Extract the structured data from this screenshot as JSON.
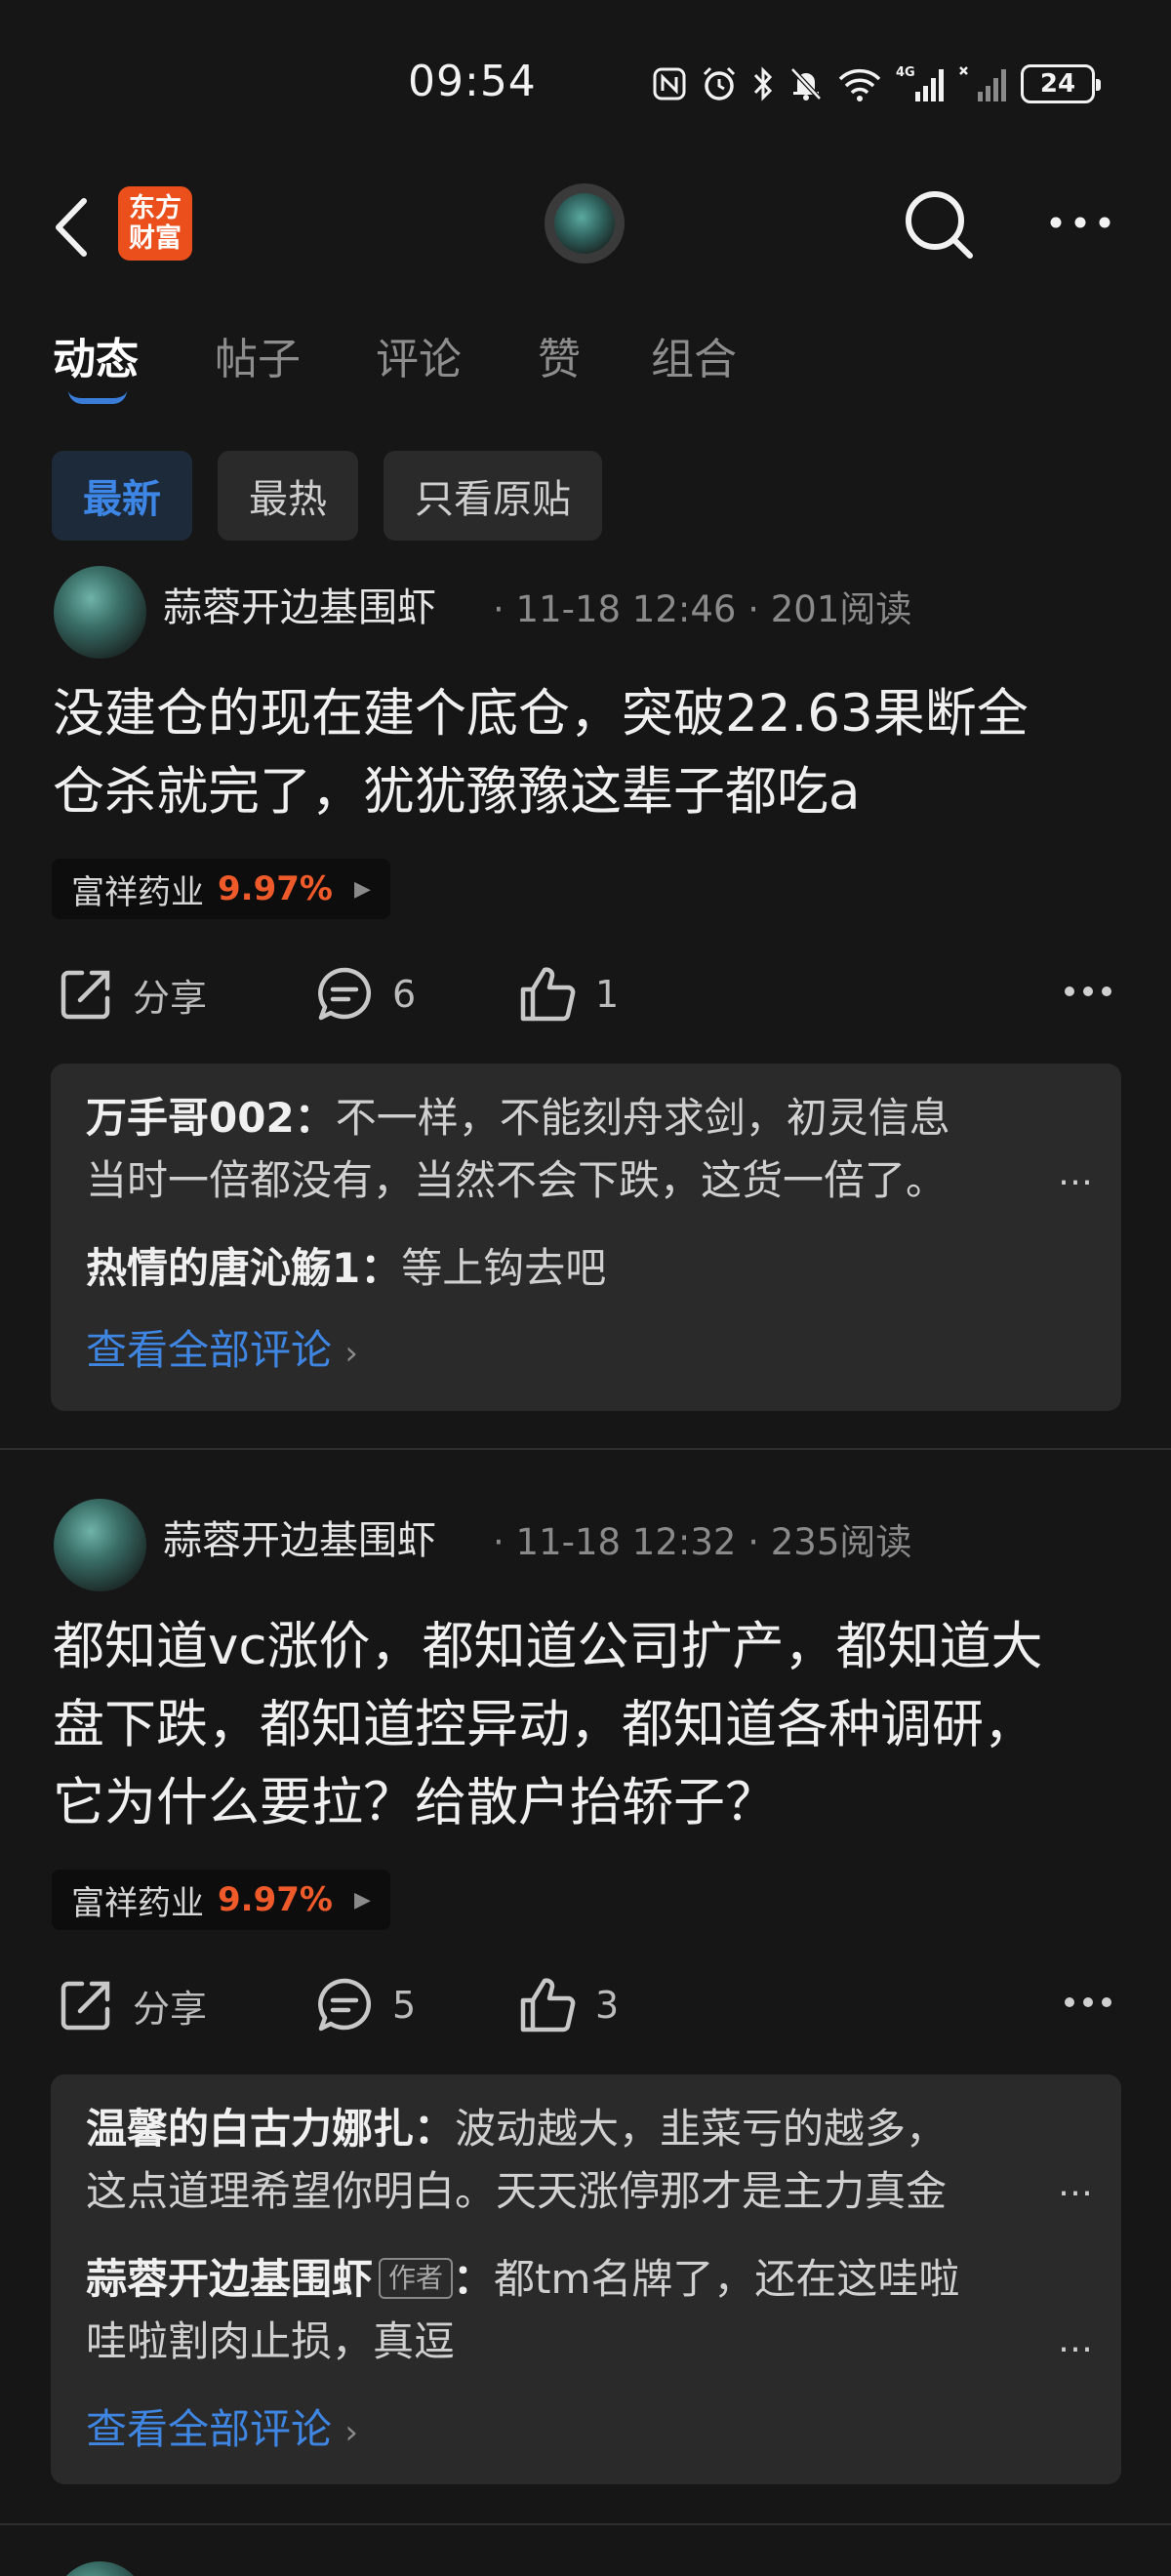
{
  "status_bar": {
    "time": "09:54",
    "battery": "24",
    "network": "4G"
  },
  "nav": {
    "logo_text_line1": "东方",
    "logo_text_line2": "财富"
  },
  "tabs": [
    {
      "label": "动态",
      "active": true
    },
    {
      "label": "帖子",
      "active": false
    },
    {
      "label": "评论",
      "active": false
    },
    {
      "label": "赞",
      "active": false
    },
    {
      "label": "组合",
      "active": false
    }
  ],
  "filters": [
    {
      "label": "最新",
      "active": true
    },
    {
      "label": "最热",
      "active": false
    },
    {
      "label": "只看原贴",
      "active": false
    }
  ],
  "colors": {
    "accent": "#3d86e6",
    "stock_up": "#ee5a2a",
    "brand_logo": "#ea4f1c",
    "background": "#161616"
  },
  "posts": [
    {
      "author": "蒜蓉开边基围虾",
      "datetime": "11-18 12:46",
      "reads": "201阅读",
      "content_line1": "没建仓的现在建个底仓，突破22.63果断全",
      "content_line2": "仓杀就完了，犹犹豫豫这辈子都吃a",
      "stock_name": "富祥药业",
      "stock_change": "9.97%",
      "share_label": "分享",
      "comment_count": "6",
      "like_count": "1",
      "comments": [
        {
          "user": "万手哥002",
          "line1": "不一样，不能刻舟求剑，初灵信息",
          "line2": "当时一倍都没有，当然不会下跌，这货一倍了。"
        },
        {
          "user": "热情的唐沁觞1",
          "line1": "等上钩去吧"
        }
      ],
      "view_all": "查看全部评论"
    },
    {
      "author": "蒜蓉开边基围虾",
      "datetime": "11-18 12:32",
      "reads": "235阅读",
      "content_line1": "都知道vc涨价，都知道公司扩产，都知道大",
      "content_line2": "盘下跌，都知道控异动，都知道各种调研，",
      "content_line3": "它为什么要拉？给散户抬轿子？",
      "stock_name": "富祥药业",
      "stock_change": "9.97%",
      "share_label": "分享",
      "comment_count": "5",
      "like_count": "3",
      "comments": [
        {
          "user": "温馨的白古力娜扎",
          "line1": "波动越大，韭菜亏的越多，",
          "line2": "这点道理希望你明白。天天涨停那才是主力真金"
        },
        {
          "user": "蒜蓉开边基围虾",
          "badge": "作者",
          "line1": "都tm名牌了，还在这哇啦",
          "line2": "哇啦割肉止损，真逗"
        }
      ],
      "view_all": "查看全部评论"
    }
  ]
}
